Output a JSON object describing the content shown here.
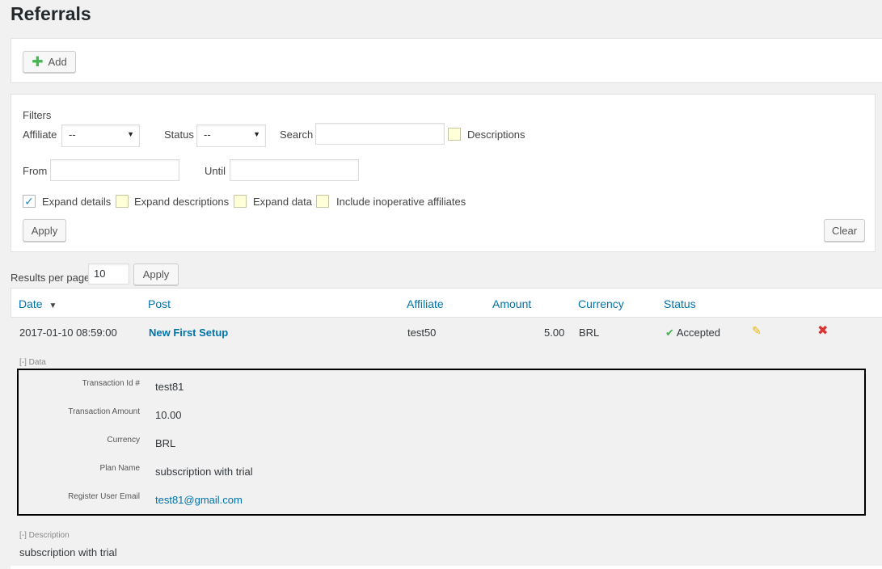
{
  "page": {
    "title": "Referrals"
  },
  "toolbar": {
    "add_label": "Add"
  },
  "filters": {
    "heading": "Filters",
    "affiliate_label": "Affiliate",
    "affiliate_value": "--",
    "status_label": "Status",
    "status_value": "--",
    "search_label": "Search",
    "search_value": "",
    "descriptions_label": "Descriptions",
    "from_label": "From",
    "from_value": "",
    "until_label": "Until",
    "until_value": "",
    "expand_details_label": "Expand details",
    "expand_details_checked": true,
    "expand_descriptions_label": "Expand descriptions",
    "expand_data_label": "Expand data",
    "include_inoperative_label": "Include inoperative affiliates",
    "apply_label": "Apply",
    "clear_label": "Clear"
  },
  "pagination": {
    "results_per_page_label": "Results per page",
    "results_per_page_value": "10",
    "apply_label": "Apply"
  },
  "table": {
    "columns": {
      "date": "Date",
      "post": "Post",
      "affiliate": "Affiliate",
      "amount": "Amount",
      "currency": "Currency",
      "status": "Status"
    },
    "sort_indicator": "▼",
    "row": {
      "date": "2017-01-10 08:59:00",
      "post": "New First Setup",
      "affiliate": "test50",
      "amount": "5.00",
      "currency": "BRL",
      "status": "Accepted",
      "status_icon": "check-icon",
      "edit_icon": "pencil-icon",
      "delete_icon": "delete-x-icon"
    },
    "data_toggle": "[-] Data",
    "data": [
      {
        "label": "Transaction Id #",
        "value": "test81"
      },
      {
        "label": "Transaction Amount",
        "value": "10.00"
      },
      {
        "label": "Currency",
        "value": "BRL"
      },
      {
        "label": "Plan Name",
        "value": "subscription with trial"
      },
      {
        "label": "Register User Email",
        "value": "test81@gmail.com"
      }
    ],
    "description_toggle": "[-] Description",
    "description": "subscription with trial"
  },
  "colors": {
    "link": "#0073aa",
    "add_icon": "#46b450",
    "accepted": "#46b450",
    "delete": "#dc3232",
    "edit": "#f0c000"
  }
}
